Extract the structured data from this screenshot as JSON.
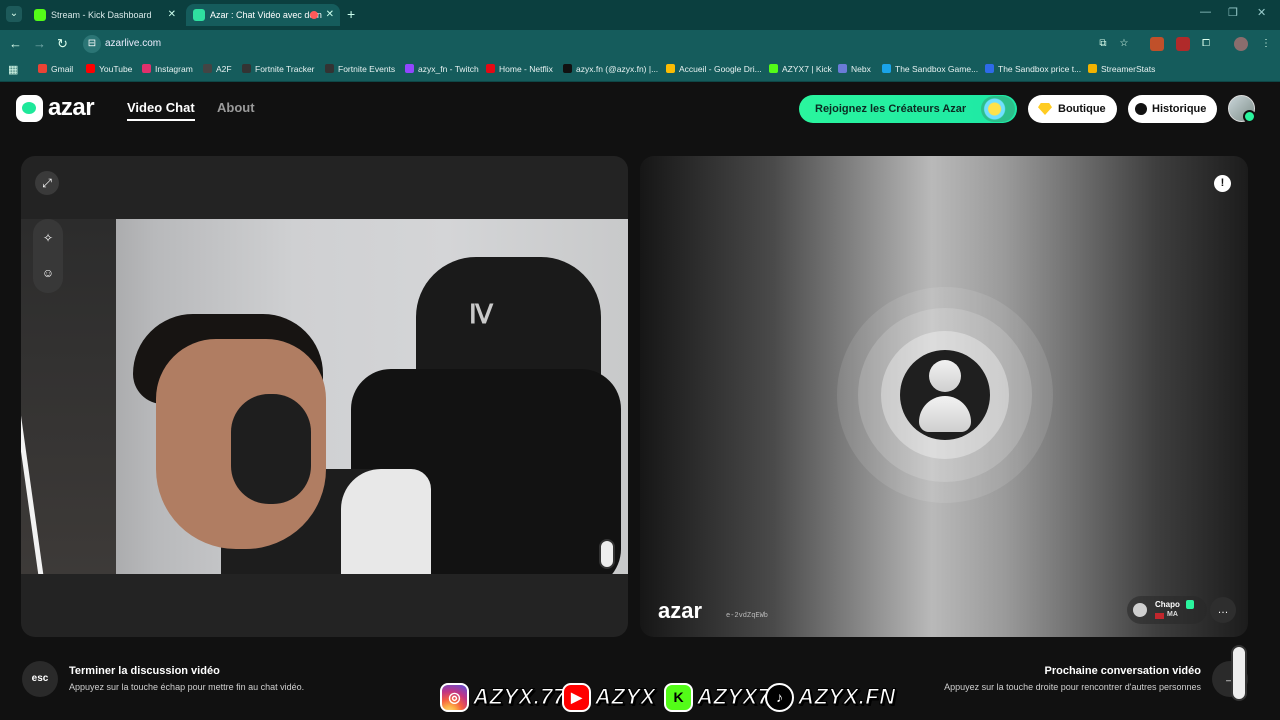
{
  "browser": {
    "tabs": [
      {
        "title": "Stream - Kick Dashboard",
        "active": false
      },
      {
        "title": "Azar : Chat Vidéo avec de n",
        "active": true
      }
    ],
    "url": "azarlive.com",
    "bookmarks": [
      {
        "label": "Gmail",
        "color": "#ea4335"
      },
      {
        "label": "YouTube",
        "color": "#ff0000"
      },
      {
        "label": "Instagram",
        "color": "#e1306c"
      },
      {
        "label": "A2F",
        "color": "#444444"
      },
      {
        "label": "Fortnite Tracker",
        "color": "#333333"
      },
      {
        "label": "Fortnite Events",
        "color": "#333333"
      },
      {
        "label": "azyx_fn - Twitch",
        "color": "#9146ff"
      },
      {
        "label": "Home - Netflix",
        "color": "#e50914"
      },
      {
        "label": "azyx.fn (@azyx.fn) |...",
        "color": "#111111"
      },
      {
        "label": "Accueil - Google Dri...",
        "color": "#fbbc04"
      },
      {
        "label": "AZYX7 | Kick",
        "color": "#53fc18"
      },
      {
        "label": "Nebx",
        "color": "#6a7bd8"
      },
      {
        "label": "The Sandbox Game...",
        "color": "#1aa3e8"
      },
      {
        "label": "The Sandbox price t...",
        "color": "#2e6ae8"
      },
      {
        "label": "StreamerStats",
        "color": "#f2b300"
      }
    ]
  },
  "site": {
    "logo": "azar",
    "nav": {
      "video_chat": "Video Chat",
      "about": "About"
    },
    "buttons": {
      "creators": "Rejoignez les Créateurs Azar",
      "shop": "Boutique",
      "history": "Historique"
    }
  },
  "remote": {
    "watermark": "azar",
    "id": "e-2vdZqEWb",
    "peer_name": "Chapo",
    "peer_country": "MA"
  },
  "footer": {
    "esc_key": "esc",
    "end_title": "Terminer la discussion vidéo",
    "end_sub": "Appuyez sur la touche échap pour mettre fin au chat vidéo.",
    "next_title": "Prochaine conversation vidéo",
    "next_sub": "Appuyez sur la touche droite pour rencontrer d'autres personnes",
    "next_key": "→"
  },
  "overlay": {
    "instagram": "AZYX.77",
    "youtube": "AZYX",
    "kick": "AZYX7",
    "tiktok": "AZYX.FN"
  },
  "colors": {
    "accent": "#2af59e",
    "browser_frame": "#155c5c",
    "background": "#111111"
  }
}
